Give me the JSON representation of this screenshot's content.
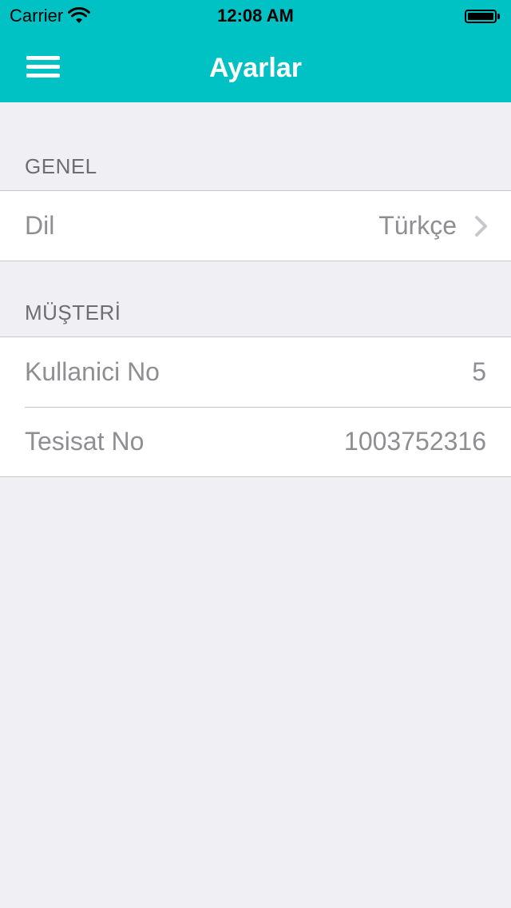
{
  "status_bar": {
    "carrier": "Carrier",
    "time": "12:08 AM",
    "battery_level": 1.0
  },
  "nav": {
    "title": "Ayarlar",
    "menu_icon": "hamburger-menu-icon"
  },
  "colors": {
    "header": "#00c2c4",
    "background": "#efeff4",
    "text_secondary": "#8e8e93"
  },
  "sections": {
    "general": {
      "title": "GENEL",
      "rows": [
        {
          "label": "Dil",
          "value": "Türkçe"
        }
      ]
    },
    "customer": {
      "title": "MÜŞTERİ",
      "rows": [
        {
          "label": "Kullanici No",
          "value": "5"
        },
        {
          "label": "Tesisat No",
          "value": "1003752316"
        }
      ]
    }
  }
}
